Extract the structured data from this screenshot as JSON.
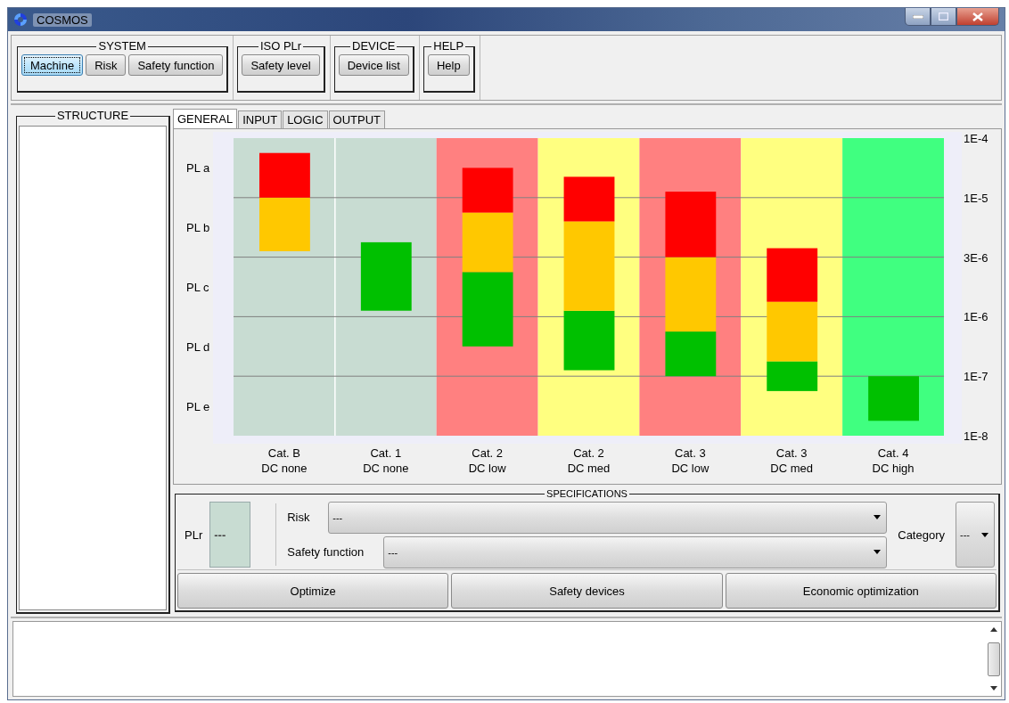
{
  "window": {
    "title": "COSMOS"
  },
  "toolbar": {
    "groups": [
      {
        "title": "SYSTEM",
        "buttons": [
          {
            "label": "Machine",
            "selected": true
          },
          {
            "label": "Risk",
            "selected": false
          },
          {
            "label": "Safety function",
            "selected": false
          }
        ]
      },
      {
        "title": "ISO PLr",
        "buttons": [
          {
            "label": "Safety level",
            "selected": false
          }
        ]
      },
      {
        "title": "DEVICE",
        "buttons": [
          {
            "label": "Device list",
            "selected": false
          }
        ]
      },
      {
        "title": "HELP",
        "buttons": [
          {
            "label": "Help",
            "selected": false
          }
        ]
      }
    ]
  },
  "structure": {
    "title": "STRUCTURE"
  },
  "tabs": [
    {
      "label": "GENERAL",
      "selected": true
    },
    {
      "label": "INPUT",
      "selected": false
    },
    {
      "label": "LOGIC",
      "selected": false
    },
    {
      "label": "OUTPUT",
      "selected": false
    }
  ],
  "chart": {
    "band_labels": [
      "PL a",
      "PL b",
      "PL c",
      "PL d",
      "PL e"
    ],
    "scale_labels": [
      "1E-4",
      "1E-5",
      "3E-6",
      "1E-6",
      "1E-7",
      "1E-8"
    ],
    "columns": [
      {
        "label": "Cat. B",
        "sublabel": "DC none",
        "color": "#c8dcd2"
      },
      {
        "label": "Cat. 1",
        "sublabel": "DC none",
        "color": "#c8dcd2"
      },
      {
        "label": "Cat. 2",
        "sublabel": "DC low",
        "color": "#ff8080"
      },
      {
        "label": "Cat. 2",
        "sublabel": "DC med",
        "color": "#ffff80"
      },
      {
        "label": "Cat. 3",
        "sublabel": "DC low",
        "color": "#ff8080"
      },
      {
        "label": "Cat. 3",
        "sublabel": "DC med",
        "color": "#ffff80"
      },
      {
        "label": "Cat. 4",
        "sublabel": "DC high",
        "color": "#40ff80"
      }
    ]
  },
  "specifications": {
    "title": "SPECIFICATIONS",
    "plr": {
      "label": "PLr",
      "value": "---"
    },
    "risk": {
      "label": "Risk",
      "value": "---"
    },
    "safety_function": {
      "label": "Safety function",
      "value": "---"
    },
    "category": {
      "label": "Category",
      "value": "---"
    },
    "buttons": [
      "Optimize",
      "Safety devices",
      "Economic optimization"
    ]
  }
}
